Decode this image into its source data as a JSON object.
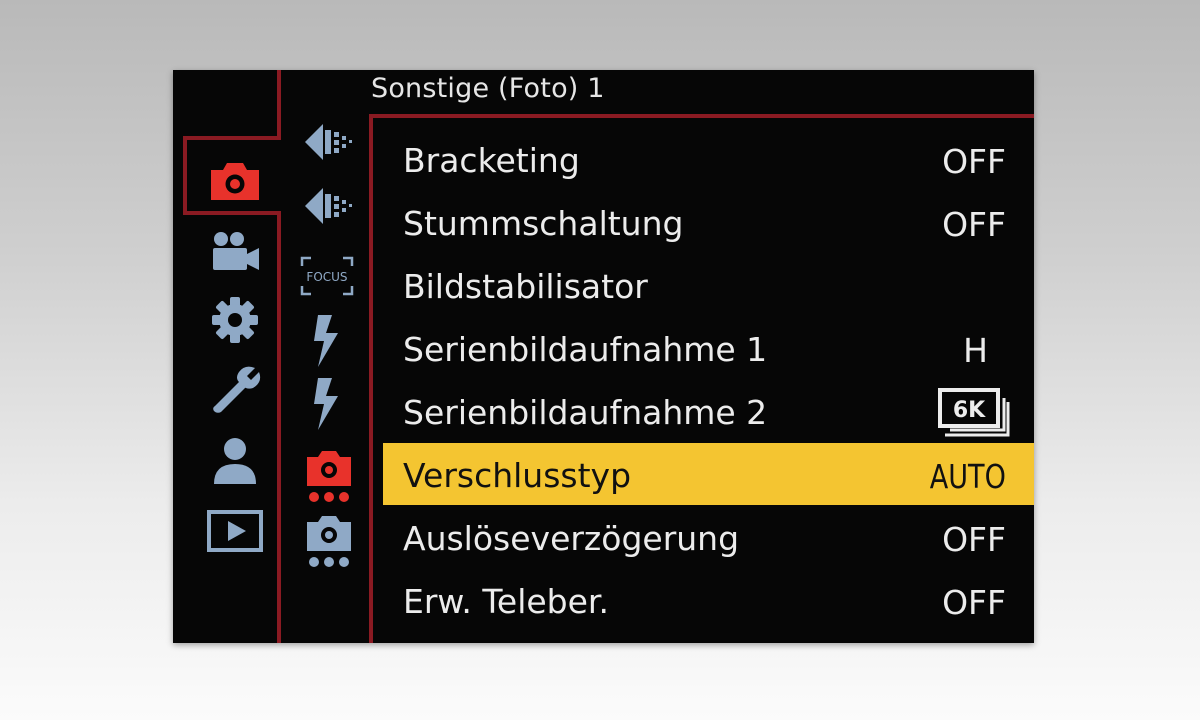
{
  "menu": {
    "title": "Sonstige (Foto) 1",
    "items": [
      {
        "label": "Bracketing",
        "value": "OFF"
      },
      {
        "label": "Stummschaltung",
        "value": "OFF"
      },
      {
        "label": "Bildstabilisator",
        "value": ""
      },
      {
        "label": "Serienbildaufnahme 1",
        "value": "H"
      },
      {
        "label": "Serienbildaufnahme 2",
        "value": "",
        "value_icon": "6k-photo-icon",
        "value_icon_text": "6K"
      },
      {
        "label": "Verschlusstyp",
        "value": "AUTO",
        "selected": true
      },
      {
        "label": "Auslöseverzögerung",
        "value": "OFF"
      },
      {
        "label": "Erw. Teleber.",
        "value": "OFF"
      }
    ]
  },
  "categories": [
    {
      "icon": "photo-camera-icon",
      "active": true
    },
    {
      "icon": "video-camera-icon"
    },
    {
      "icon": "custom-gear-icon"
    },
    {
      "icon": "setup-wrench-icon"
    },
    {
      "icon": "my-menu-person-icon"
    },
    {
      "icon": "playback-icon"
    }
  ],
  "subtabs": [
    {
      "icon": "quality-dots-icon"
    },
    {
      "icon": "quality-dots-icon"
    },
    {
      "icon": "focus-icon",
      "text": "FOCUS"
    },
    {
      "icon": "flash-icon"
    },
    {
      "icon": "flash-icon"
    },
    {
      "icon": "camera-other-icon",
      "active": true
    },
    {
      "icon": "camera-other-icon"
    }
  ],
  "colors": {
    "accent_red": "#8a1a22",
    "active_icon": "#e8322b",
    "icon_blue": "#8fa9c6",
    "selected_row": "#f4c531"
  }
}
